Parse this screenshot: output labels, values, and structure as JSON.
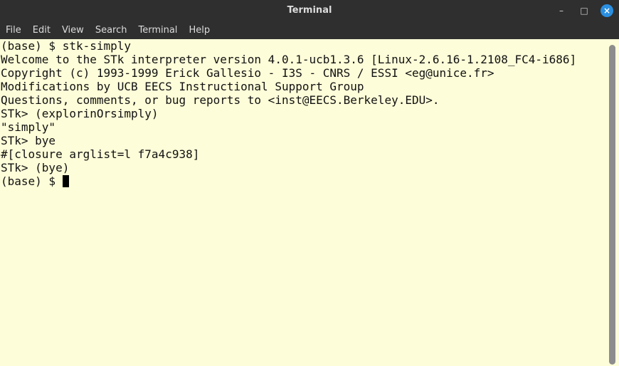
{
  "window": {
    "title": "Terminal",
    "controls": {
      "minimize_icon": "minimize-icon",
      "maximize_icon": "maximize-icon",
      "close_icon": "close-icon",
      "minimize_glyph": "–",
      "maximize_glyph": "□",
      "close_glyph": "×"
    },
    "accent_color": "#2b8fe0"
  },
  "menu": {
    "items": [
      "File",
      "Edit",
      "View",
      "Search",
      "Terminal",
      "Help"
    ]
  },
  "terminal": {
    "background": "#fdfdd9",
    "lines": [
      "(base) $ stk-simply",
      "Welcome to the STk interpreter version 4.0.1-ucb1.3.6 [Linux-2.6.16-1.2108_FC4-i686]",
      "Copyright (c) 1993-1999 Erick Gallesio - I3S - CNRS / ESSI <eg@unice.fr>",
      "Modifications by UCB EECS Instructional Support Group",
      "Questions, comments, or bug reports to <inst@EECS.Berkeley.EDU>.",
      "STk> (explorinOrsimply)",
      "\"simply\"",
      "STk> bye",
      "#[closure arglist=l f7a4c938]",
      "STk> (bye)"
    ],
    "prompt": "(base) $ "
  }
}
